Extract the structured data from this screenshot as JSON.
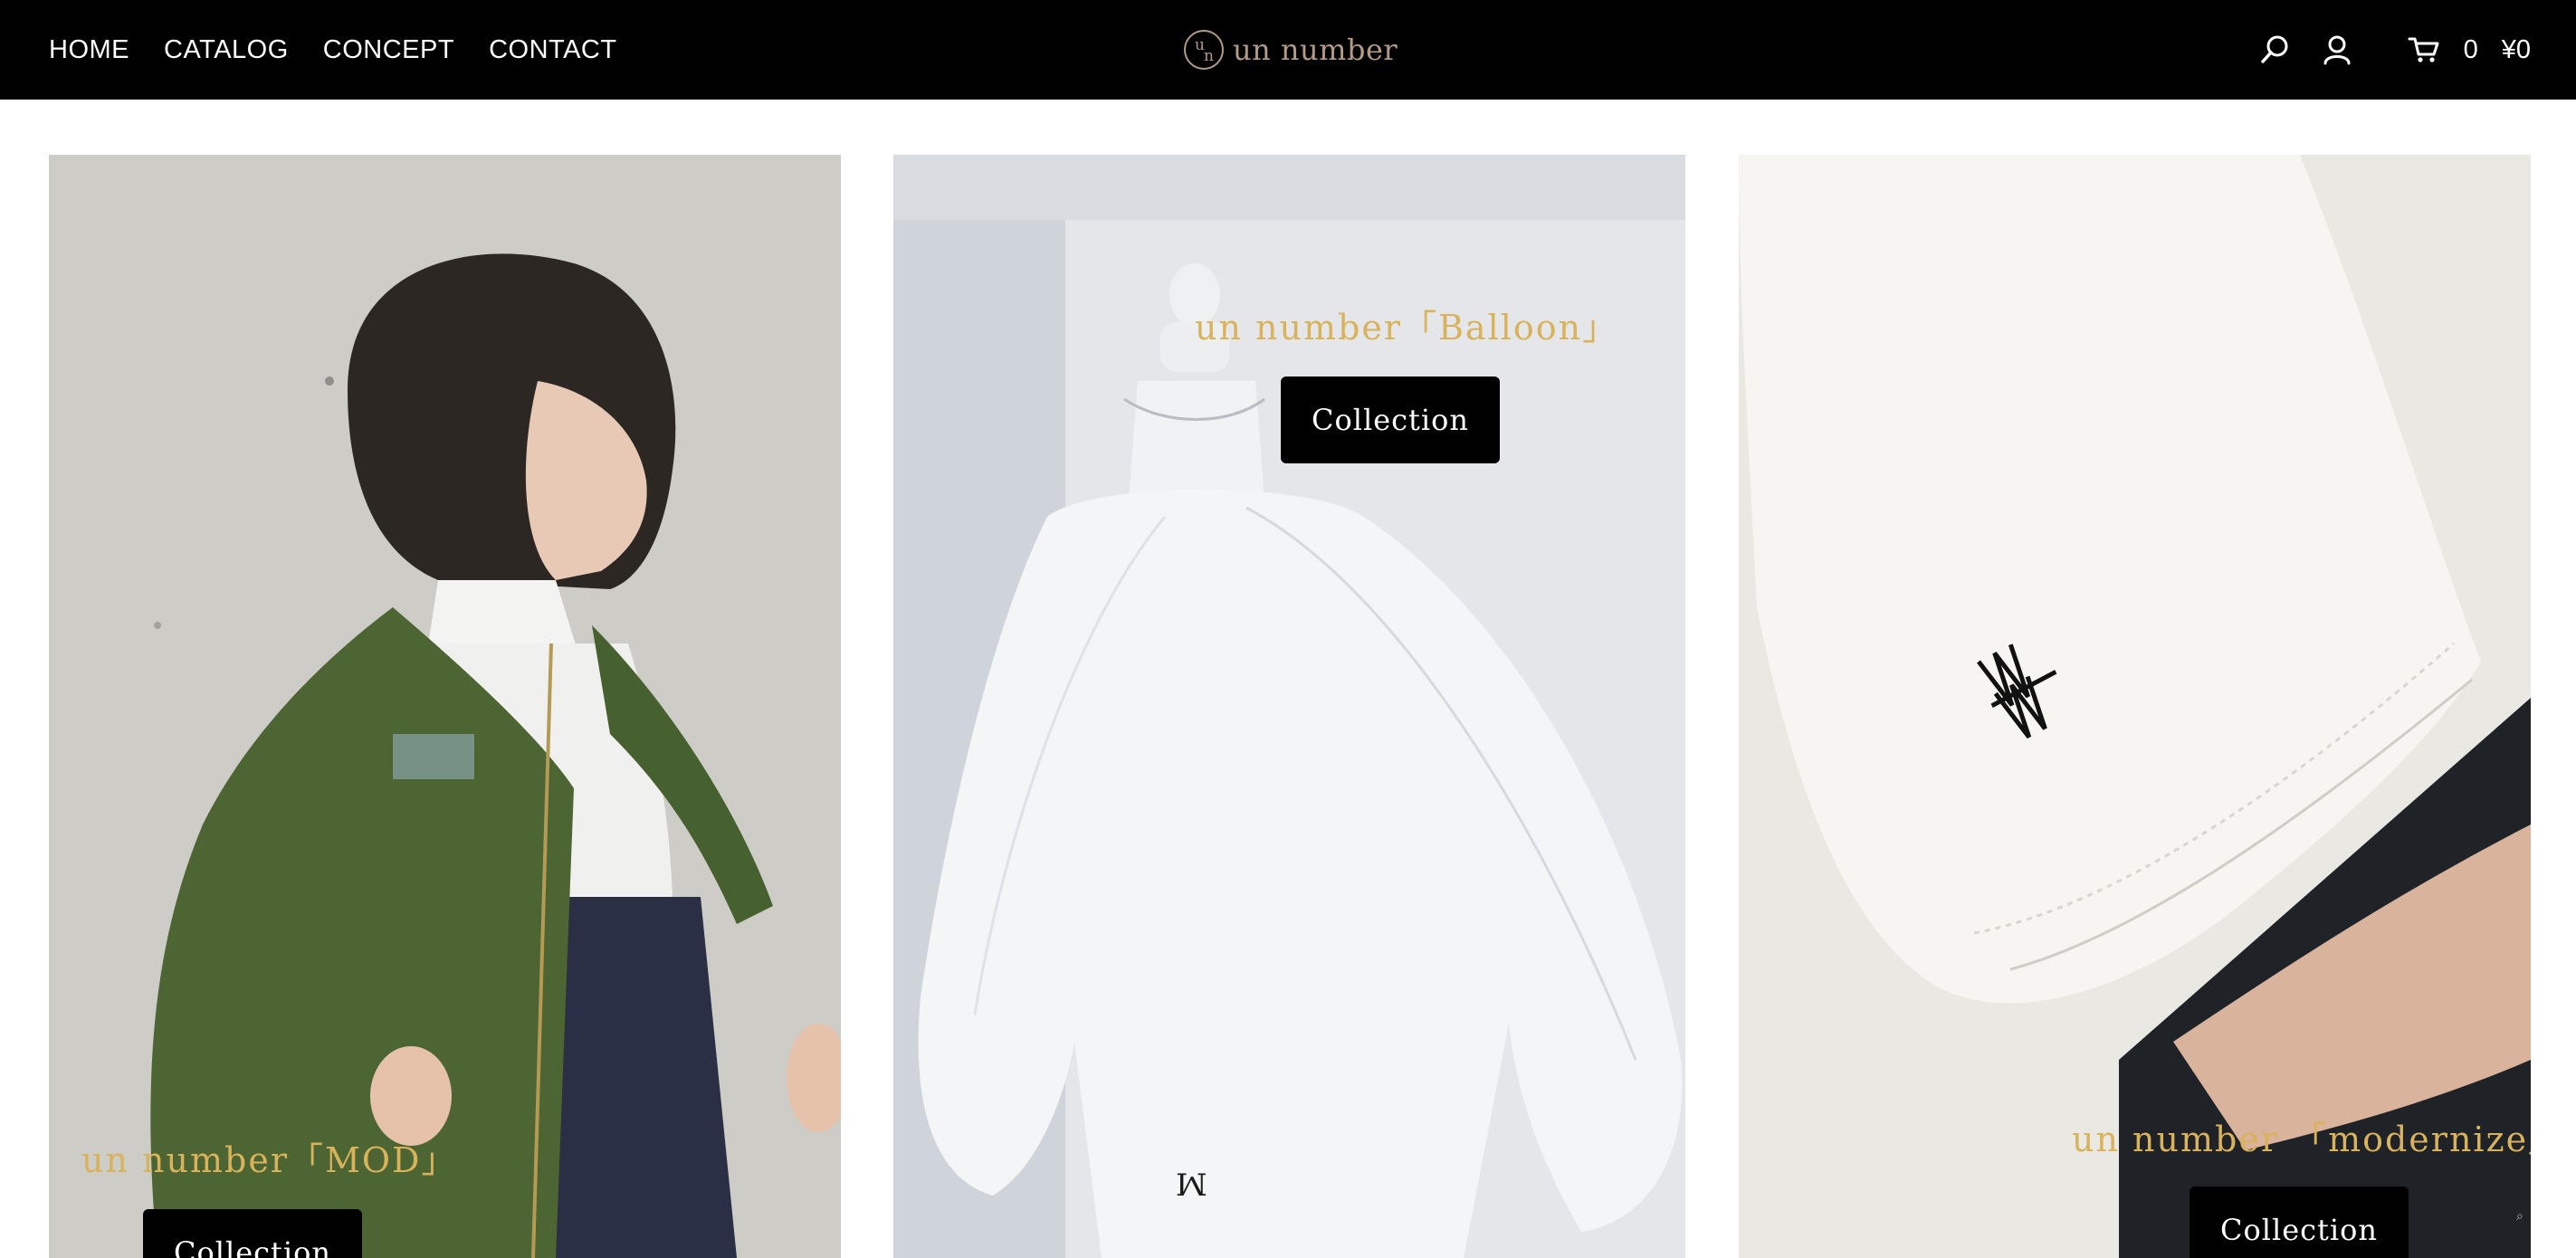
{
  "nav": {
    "items": [
      {
        "label": "HOME"
      },
      {
        "label": "CATALOG"
      },
      {
        "label": "CONCEPT"
      },
      {
        "label": "CONTACT"
      }
    ]
  },
  "brand": {
    "name": "un number",
    "mark_u": "u",
    "mark_n": "n"
  },
  "header_tools": {
    "search_icon": "search-icon",
    "account_icon": "user-icon",
    "cart_icon": "cart-icon",
    "cart_count": "0",
    "cart_total": "¥0"
  },
  "collections": [
    {
      "title": "un number「MOD」",
      "button_label": "Collection"
    },
    {
      "title": "un number「Balloon」",
      "button_label": "Collection"
    },
    {
      "title": "un number 「modernize」",
      "button_label": "Collection"
    }
  ],
  "colors": {
    "header_bg": "#000000",
    "brand": "#b39a86",
    "overlay_title": "#d9b25c",
    "button_bg": "#000000",
    "button_text": "#ffffff"
  }
}
